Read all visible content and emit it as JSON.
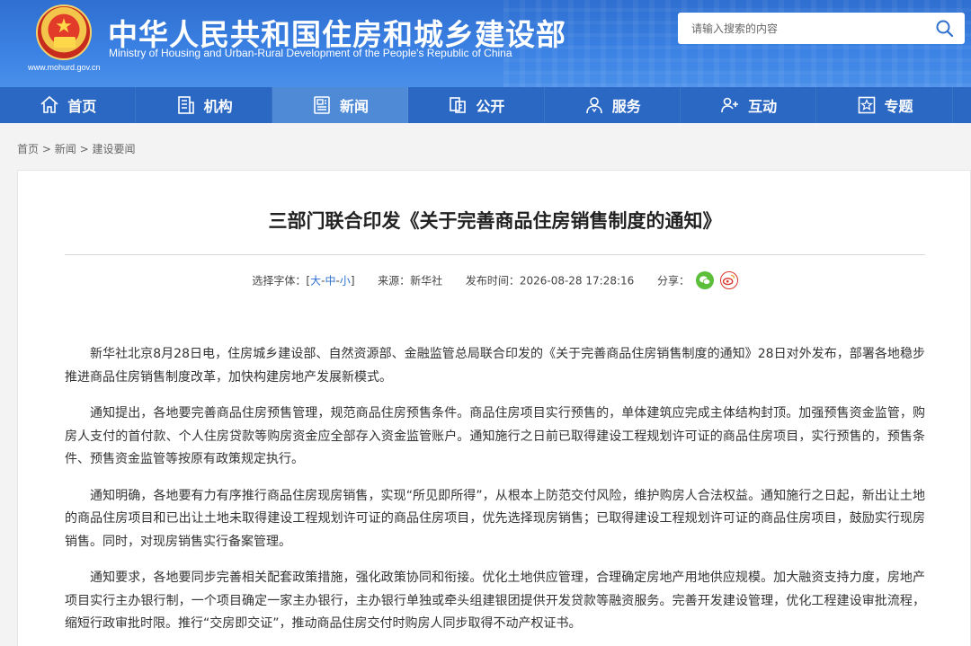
{
  "header": {
    "title_cn": "中华人民共和国住房和城乡建设部",
    "title_en": "Ministry of Housing and Urban-Rural Development of the People's Republic of China",
    "site_url": "www.mohurd.gov.cn",
    "search_placeholder": "请输入搜索的内容"
  },
  "nav": [
    {
      "label": "首页",
      "icon": "home-icon"
    },
    {
      "label": "机构",
      "icon": "building-icon"
    },
    {
      "label": "新闻",
      "icon": "news-icon",
      "active": true
    },
    {
      "label": "公开",
      "icon": "disclosure-icon"
    },
    {
      "label": "服务",
      "icon": "service-icon"
    },
    {
      "label": "互动",
      "icon": "interaction-icon"
    },
    {
      "label": "专题",
      "icon": "topic-icon"
    }
  ],
  "breadcrumb": {
    "home": "首页",
    "news": "新闻",
    "section": "建设要闻",
    "sep": ">"
  },
  "article": {
    "title": "三部门联合印发《关于完善商品住房销售制度的通知》",
    "font_select_label": "选择字体：[",
    "font_large": "大",
    "font_medium": "中",
    "font_small": "小",
    "font_dash": "-",
    "font_close": "]",
    "source": "来源：新华社",
    "publish_time": "发布时间：2026-08-28 17:28:16",
    "share_label": "分享：",
    "paragraphs": [
      "新华社北京8月28日电，住房城乡建设部、自然资源部、金融监管总局联合印发的《关于完善商品住房销售制度的通知》28日对外发布，部署各地稳步推进商品住房销售制度改革，加快构建房地产发展新模式。",
      "通知提出，各地要完善商品住房预售管理，规范商品住房预售条件。商品住房项目实行预售的，单体建筑应完成主体结构封顶。加强预售资金监管，购房人支付的首付款、个人住房贷款等购房资金应全部存入资金监管账户。通知施行之日前已取得建设工程规划许可证的商品住房项目，实行预售的，预售条件、预售资金监管等按原有政策规定执行。",
      "通知明确，各地要有力有序推行商品住房现房销售，实现“所见即所得”，从根本上防范交付风险，维护购房人合法权益。通知施行之日起，新出让土地的商品住房项目和已出让土地未取得建设工程规划许可证的商品住房项目，优先选择现房销售；已取得建设工程规划许可证的商品住房项目，鼓励实行现房销售。同时，对现房销售实行备案管理。",
      "通知要求，各地要同步完善相关配套政策措施，强化政策协同和衔接。优化土地供应管理，合理确定房地产用地供应规模。加大融资支持力度，房地产项目实行主办银行制，一个项目确定一家主办银行，主办银行单独或牵头组建银团提供开发贷款等融资服务。完善开发建设管理，优化工程建设审批流程，缩短行政审批时限。推行“交房即交证”，推动商品住房交付时购房人同步取得不动产权证书。"
    ]
  },
  "colors": {
    "header_blue": "#3b82e4",
    "nav_blue": "#2b68c3",
    "nav_active": "#4e8ad6",
    "link_blue": "#2f6fd0"
  }
}
